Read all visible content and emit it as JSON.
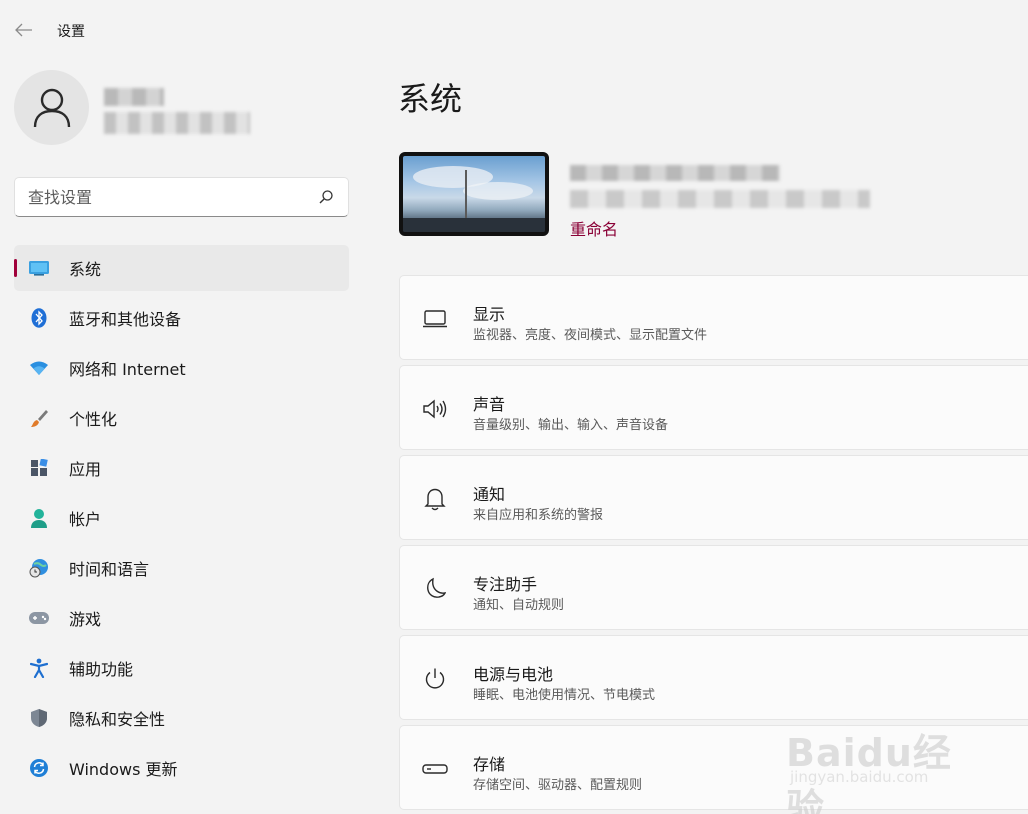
{
  "window": {
    "title": "设置"
  },
  "account": {
    "name": "",
    "email": ""
  },
  "search": {
    "placeholder": "查找设置"
  },
  "nav": {
    "items": [
      {
        "label": "系统",
        "icon": "system-icon"
      },
      {
        "label": "蓝牙和其他设备",
        "icon": "bluetooth-icon"
      },
      {
        "label": "网络和 Internet",
        "icon": "wifi-icon"
      },
      {
        "label": "个性化",
        "icon": "brush-icon"
      },
      {
        "label": "应用",
        "icon": "apps-icon"
      },
      {
        "label": "帐户",
        "icon": "person-icon"
      },
      {
        "label": "时间和语言",
        "icon": "globe-clock-icon"
      },
      {
        "label": "游戏",
        "icon": "gamepad-icon"
      },
      {
        "label": "辅助功能",
        "icon": "accessibility-icon"
      },
      {
        "label": "隐私和安全性",
        "icon": "shield-icon"
      },
      {
        "label": "Windows 更新",
        "icon": "update-icon"
      }
    ],
    "active": 0
  },
  "main": {
    "title": "系统",
    "device": {
      "name": "",
      "model": "",
      "rename_label": "重命名"
    },
    "cards": [
      {
        "title": "显示",
        "desc": "监视器、亮度、夜间模式、显示配置文件",
        "icon": "monitor-icon"
      },
      {
        "title": "声音",
        "desc": "音量级别、输出、输入、声音设备",
        "icon": "speaker-icon"
      },
      {
        "title": "通知",
        "desc": "来自应用和系统的警报",
        "icon": "bell-icon"
      },
      {
        "title": "专注助手",
        "desc": "通知、自动规则",
        "icon": "moon-icon"
      },
      {
        "title": "电源与电池",
        "desc": "睡眠、电池使用情况、节电模式",
        "icon": "power-icon"
      },
      {
        "title": "存储",
        "desc": "存储空间、驱动器、配置规则",
        "icon": "storage-icon"
      }
    ]
  },
  "watermark": {
    "logo": "Baidu经验",
    "url": "jingyan.baidu.com"
  },
  "colors": {
    "accent": "#a0003a",
    "link": "#8a0036",
    "background": "#f3f3f3",
    "card": "#fbfbfb"
  }
}
